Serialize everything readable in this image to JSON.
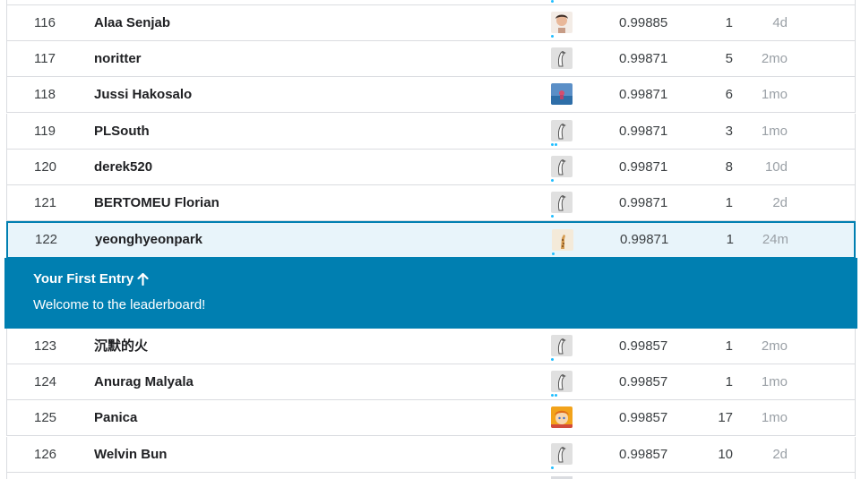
{
  "leaderboard": {
    "rows": [
      {
        "rank": "116",
        "name": "Alaa Senjab",
        "score": "0.99885",
        "entries": "1",
        "last": "4d",
        "avatar": "photo-face",
        "tiers": 1
      },
      {
        "rank": "117",
        "name": "noritter",
        "score": "0.99871",
        "entries": "5",
        "last": "2mo",
        "avatar": "goose",
        "tiers": 0
      },
      {
        "rank": "118",
        "name": "Jussi Hakosalo",
        "score": "0.99871",
        "entries": "6",
        "last": "1mo",
        "avatar": "photo-landscape",
        "tiers": 0
      },
      {
        "rank": "119",
        "name": "PLSouth",
        "score": "0.99871",
        "entries": "3",
        "last": "1mo",
        "avatar": "goose",
        "tiers": 2
      },
      {
        "rank": "120",
        "name": "derek520",
        "score": "0.99871",
        "entries": "8",
        "last": "10d",
        "avatar": "goose",
        "tiers": 1
      },
      {
        "rank": "121",
        "name": "BERTOMEU Florian",
        "score": "0.99871",
        "entries": "1",
        "last": "2d",
        "avatar": "goose",
        "tiers": 1
      },
      {
        "rank": "122",
        "name": "yeonghyeonpark",
        "score": "0.99871",
        "entries": "1",
        "last": "24m",
        "avatar": "photo-giraffe",
        "tiers": 1,
        "highlight": true
      },
      {
        "rank": "123",
        "name": "沉默的火",
        "score": "0.99857",
        "entries": "1",
        "last": "2mo",
        "avatar": "goose",
        "tiers": 1
      },
      {
        "rank": "124",
        "name": "Anurag Malyala",
        "score": "0.99857",
        "entries": "1",
        "last": "1mo",
        "avatar": "goose",
        "tiers": 2
      },
      {
        "rank": "125",
        "name": "Panica",
        "score": "0.99857",
        "entries": "17",
        "last": "1mo",
        "avatar": "photo-cartoon",
        "tiers": 0
      },
      {
        "rank": "126",
        "name": "Welvin Bun",
        "score": "0.99857",
        "entries": "10",
        "last": "2d",
        "avatar": "goose",
        "tiers": 1
      }
    ]
  },
  "banner": {
    "title": "Your First Entry",
    "title_icon": "arrow-up-icon",
    "message": "Welcome to the leaderboard!"
  },
  "colors": {
    "banner_bg": "#007fb1",
    "highlight_bg": "#e8f4fa",
    "tier_dot": "#20beff",
    "muted_text": "#9aa0a6"
  }
}
